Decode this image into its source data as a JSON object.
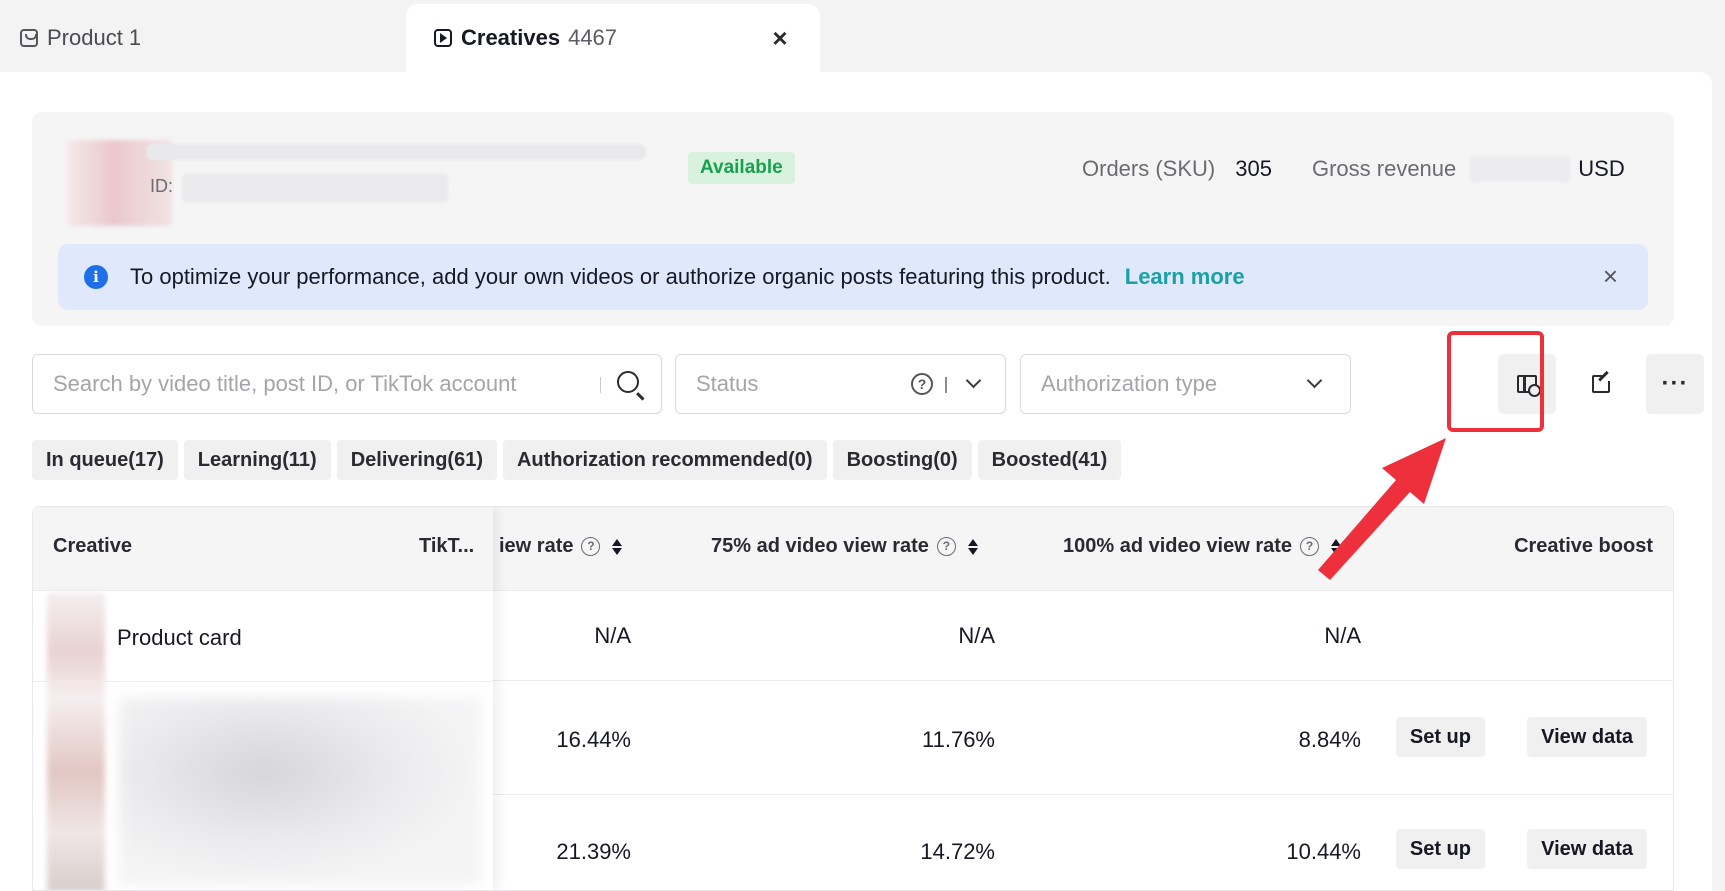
{
  "tabs": {
    "product": {
      "label": "Product 1"
    },
    "creatives": {
      "label": "Creatives",
      "count": "4467"
    }
  },
  "product": {
    "id_label": "ID:",
    "status": "Available",
    "orders_label": "Orders (SKU)",
    "orders_value": "305",
    "revenue_label": "Gross revenue",
    "revenue_currency": "USD"
  },
  "notice": {
    "text": "To optimize your performance, add your own videos or authorize organic posts featuring this product.",
    "link": "Learn more"
  },
  "filters": {
    "search_placeholder": "Search by video title, post ID, or TikTok account",
    "status_placeholder": "Status",
    "auth_placeholder": "Authorization type"
  },
  "toolbar": {
    "more_label": "···"
  },
  "chips": [
    "In queue(17)",
    "Learning(11)",
    "Delivering(61)",
    "Authorization recommended(0)",
    "Boosting(0)",
    "Boosted(41)"
  ],
  "table": {
    "headers": {
      "creative": "Creative",
      "tiktok": "TikT...",
      "view_rate": "iew rate",
      "rate75": "75% ad video view rate",
      "rate100": "100% ad video view rate",
      "boost": "Creative boost"
    },
    "rows": [
      {
        "label": "Product card",
        "c1": "N/A",
        "c2": "N/A",
        "c3": "N/A"
      },
      {
        "c1": "16.44%",
        "c2": "11.76%",
        "c3": "8.84%",
        "setup": "Set up",
        "view": "View data"
      },
      {
        "c1": "21.39%",
        "c2": "14.72%",
        "c3": "10.44%",
        "setup": "Set up",
        "view": "View data"
      }
    ]
  },
  "colors": {
    "accent_teal": "#1aa0a6",
    "available_green": "#18a14f",
    "highlight_red": "#ee2f3c",
    "info_blue": "#1e6fe8"
  }
}
